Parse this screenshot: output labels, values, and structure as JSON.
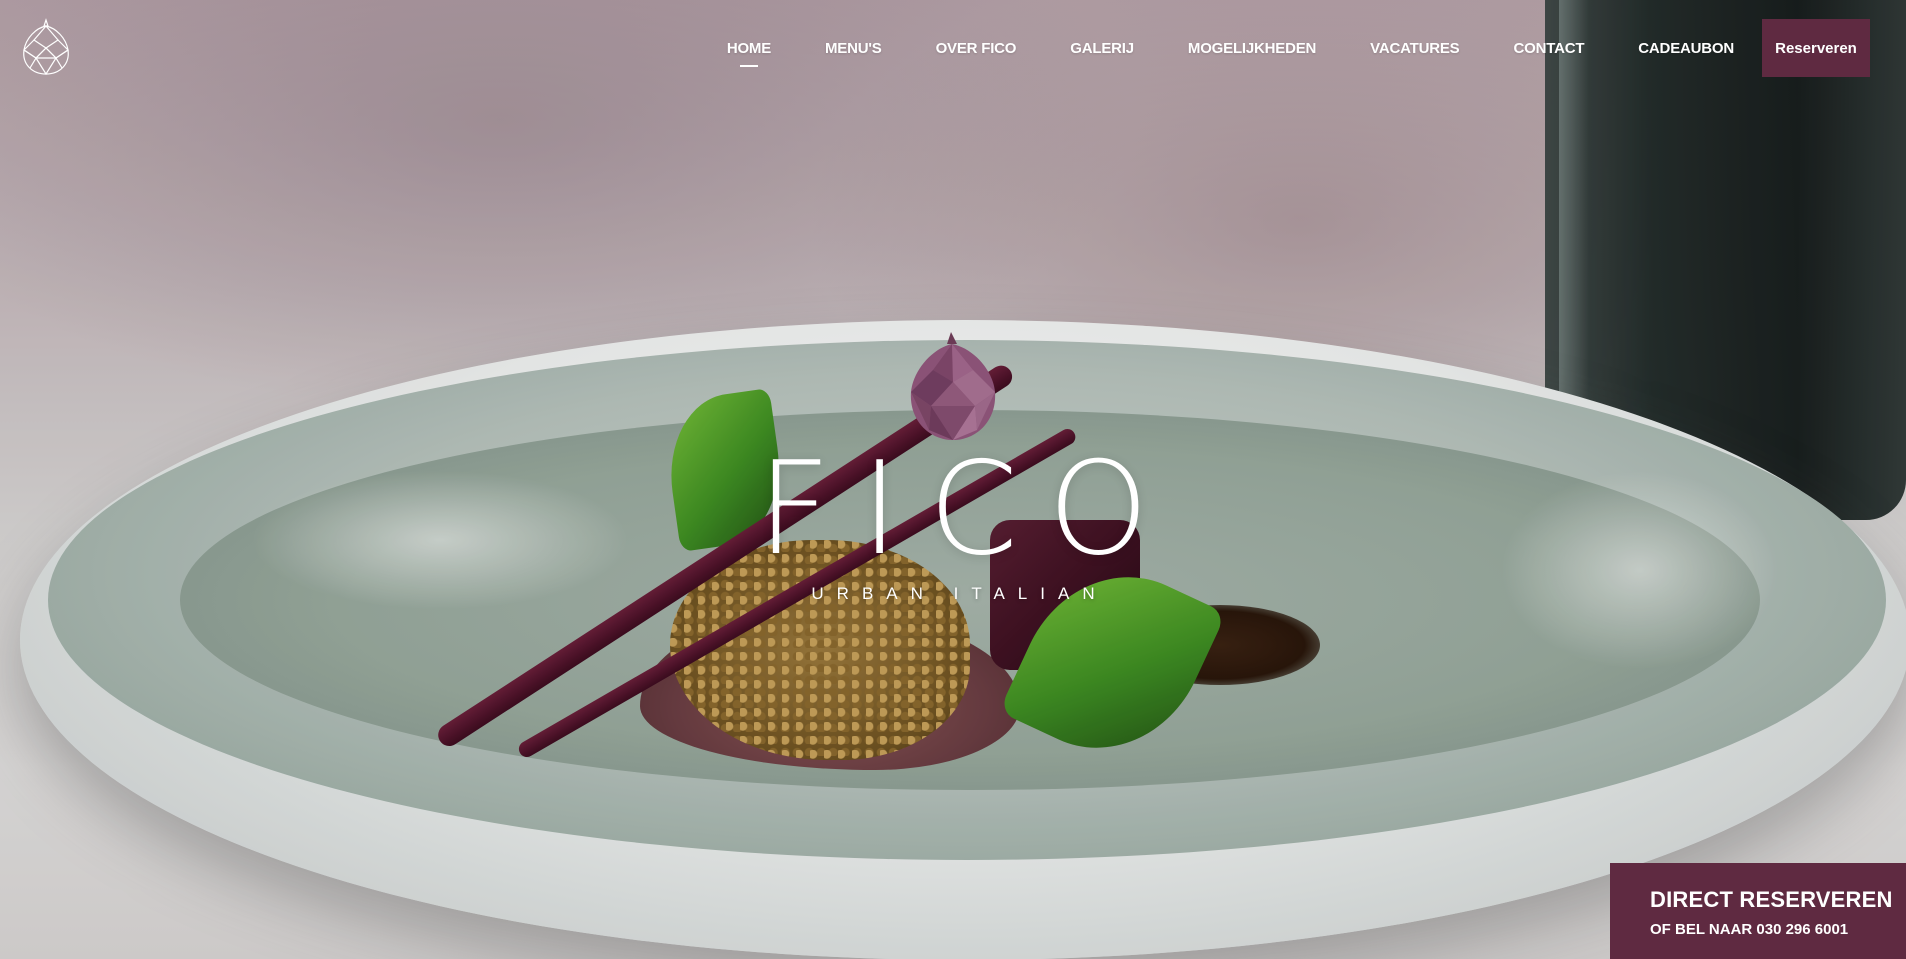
{
  "nav": {
    "items": [
      {
        "label": "HOME",
        "active": true
      },
      {
        "label": "MENU'S",
        "active": false
      },
      {
        "label": "OVER FICO",
        "active": false
      },
      {
        "label": "GALERIJ",
        "active": false
      },
      {
        "label": "MOGELIJKHEDEN",
        "active": false
      },
      {
        "label": "VACATURES",
        "active": false
      },
      {
        "label": "CONTACT",
        "active": false
      },
      {
        "label": "CADEAUBON",
        "active": false
      }
    ],
    "reserve_label": "Reserveren"
  },
  "brand": {
    "name": "FICO",
    "tagline": "URBAN ITALIAN"
  },
  "direct": {
    "title": "DIRECT RESERVEREN",
    "subtitle": "OF BEL NAAR 030 296 6001"
  },
  "colors": {
    "accent": "#5f2a41",
    "text_on_accent": "#ffffff",
    "fig_logo": "#8a5276"
  },
  "icons": {
    "logo": "fig-outline-icon",
    "brand_mark": "fig-polygon-icon"
  }
}
